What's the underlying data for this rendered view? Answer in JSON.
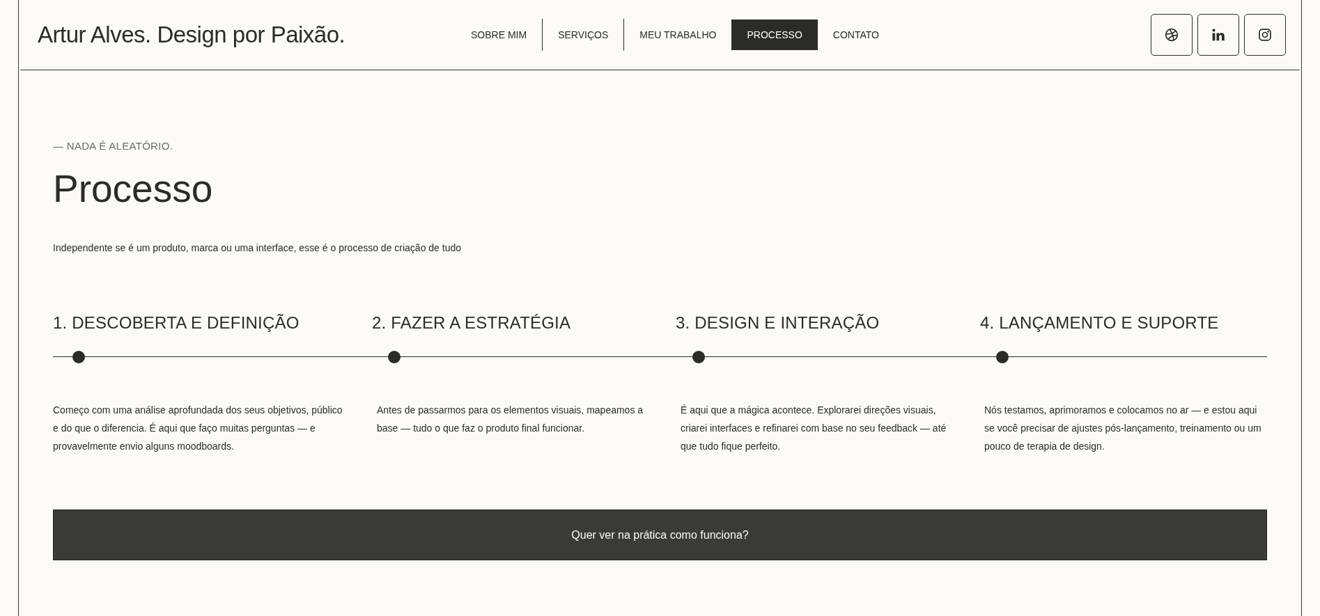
{
  "header": {
    "logo": "Artur Alves. Design por Paixão.",
    "nav": [
      {
        "label": "SOBRE MIM",
        "selected": false
      },
      {
        "label": "SERVIÇOS",
        "selected": false
      },
      {
        "label": "MEU TRABALHO",
        "selected": false
      },
      {
        "label": "PROCESSO",
        "selected": true
      },
      {
        "label": "CONTATO",
        "selected": false
      }
    ],
    "social": [
      {
        "kind": "dribbble"
      },
      {
        "kind": "linkedin"
      },
      {
        "kind": "instagram"
      }
    ]
  },
  "section": {
    "eyebrow": "— NADA É ALEATÓRIO.",
    "title": "Processo",
    "subtitle": "Independente se é um produto, marca ou uma interface, esse é o processo de criação de tudo"
  },
  "steps": [
    {
      "title": "1. DESCOBERTA E DEFINIÇÃO",
      "text": "Começo com uma análise aprofundada dos seus objetivos, público e do que o diferencia. É aqui que faço muitas perguntas — e provavelmente envio alguns moodboards."
    },
    {
      "title": "2. FAZER A ESTRATÉGIA",
      "text": "Antes de passarmos para os elementos visuais, mapeamos a base — tudo o que faz o produto final funcionar."
    },
    {
      "title": "3. DESIGN E INTERAÇÃO",
      "text": "É aqui que a mágica acontece. Explorarei direções visuais, criarei interfaces e refinarei com base no seu feedback — até que tudo fique perfeito."
    },
    {
      "title": "4. LANÇAMENTO E SUPORTE",
      "text": "Nós testamos, aprimoramos e colocamos no ar — e estou aqui se você precisar de ajustes pós-lançamento, treinamento ou um pouco de terapia de design."
    }
  ],
  "cta": {
    "label": "Quer ver na prática como funciona?"
  }
}
